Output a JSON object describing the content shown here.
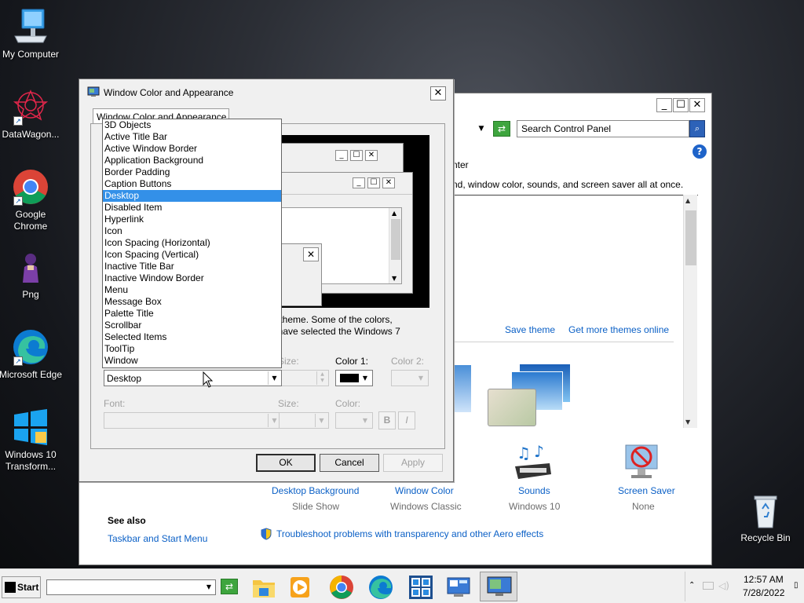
{
  "desktop": {
    "icons": [
      {
        "label": "My Computer",
        "icon": "computer-icon"
      },
      {
        "label": "DataWagon...",
        "icon": "datawagon-icon"
      },
      {
        "label": "Google Chrome",
        "icon": "chrome-icon"
      },
      {
        "label": "Png",
        "icon": "png-icon"
      },
      {
        "label": "Microsoft Edge",
        "icon": "edge-icon"
      },
      {
        "label": "Windows 10 Transform...",
        "icon": "windows-icon"
      },
      {
        "label": "Recycle Bin",
        "icon": "recycle-bin-icon"
      }
    ]
  },
  "control_panel": {
    "search_placeholder": "Search Control Panel",
    "text_top": "nter",
    "text_desc": "nd, window color, sounds, and screen saver all at once.",
    "save_theme": "Save theme",
    "get_more_themes": "Get more themes online",
    "bottom_items": [
      {
        "label": "Desktop Background",
        "sub": "Slide Show"
      },
      {
        "label": "Window Color",
        "sub": "Windows Classic"
      },
      {
        "label": "Sounds",
        "sub": "Windows 10"
      },
      {
        "label": "Screen Saver",
        "sub": "None"
      }
    ],
    "see_also_heading": "See also",
    "see_also_link": "Taskbar and Start Menu",
    "troubleshoot_link": "Troubleshoot problems with transparency and other Aero effects"
  },
  "dialog": {
    "title": "Window Color and Appearance",
    "tab": "Window Color and Appearance",
    "info_text_1": "s 7 theme.  Some of the colors,",
    "info_text_2": "ou have selected the Windows 7",
    "item_list": [
      "3D Objects",
      "Active Title Bar",
      "Active Window Border",
      "Application Background",
      "Border Padding",
      "Caption Buttons",
      "Desktop",
      "Disabled Item",
      "Hyperlink",
      "Icon",
      "Icon Spacing (Horizontal)",
      "Icon Spacing (Vertical)",
      "Inactive Title Bar",
      "Inactive Window Border",
      "Menu",
      "Message Box",
      "Palette Title",
      "Scrollbar",
      "Selected Items",
      "ToolTip",
      "Window"
    ],
    "selected_index": 6,
    "item_value": "Desktop",
    "size_label": "Size:",
    "color1_label": "Color 1:",
    "color2_label": "Color 2:",
    "font_label": "Font:",
    "font_size_label": "Size:",
    "font_color_label": "Color:",
    "bold_label": "B",
    "italic_label": "I",
    "ok": "OK",
    "cancel": "Cancel",
    "apply": "Apply",
    "color1_value": "#000000"
  },
  "taskbar": {
    "start_label": "Start",
    "time": "12:57 AM",
    "date": "7/28/2022"
  }
}
